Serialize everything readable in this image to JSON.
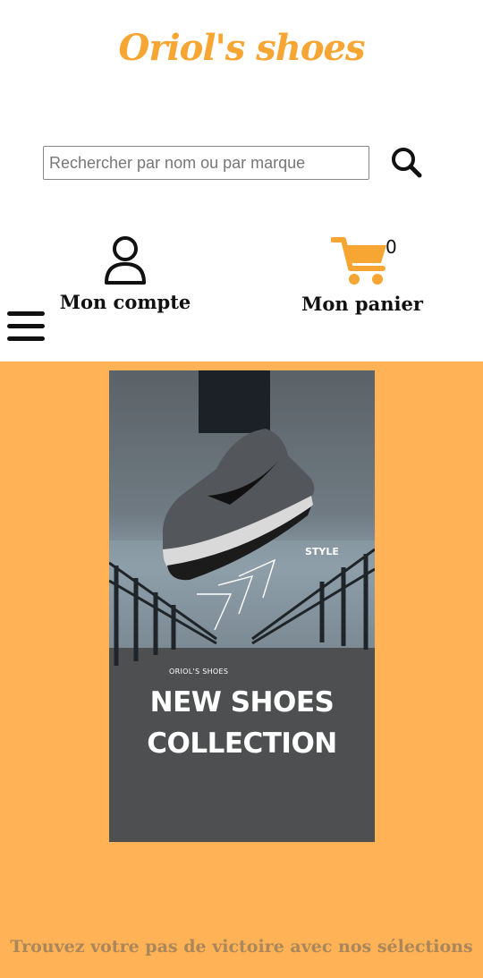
{
  "header": {
    "logo": "Oriol's shoes"
  },
  "search": {
    "placeholder": "Rechercher par nom ou par marque",
    "icon": "search-icon"
  },
  "account": {
    "label": "Mon compte",
    "icon": "user-icon"
  },
  "cart": {
    "label": "Mon panier",
    "count": "0",
    "icon": "cart-icon",
    "color": "#f7a533"
  },
  "menu": {
    "icon": "hamburger-menu-icon"
  },
  "hero": {
    "background": "#ffb256",
    "banner": {
      "brand": "ORIOL'S SHOES",
      "title_line1": "NEW SHOES",
      "title_line2": "COLLECTION",
      "style_label": "STYLE"
    },
    "tagline": "Trouvez votre pas de victoire avec nos sélections"
  }
}
